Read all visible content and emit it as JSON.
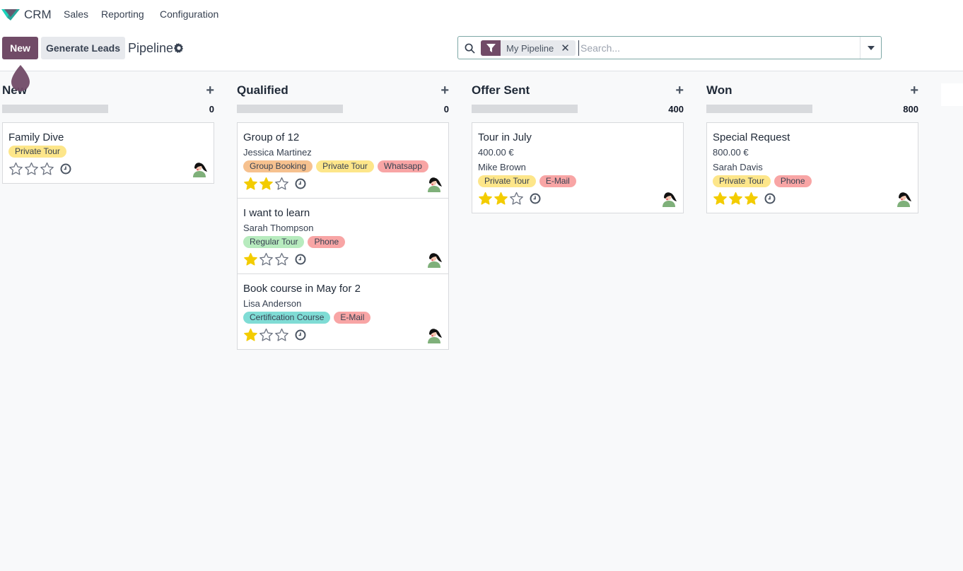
{
  "app": {
    "name": "CRM",
    "menu": [
      "Sales",
      "Reporting",
      "Configuration"
    ],
    "logo_icon": "odoo-crm-logo-icon"
  },
  "control": {
    "new_label": "New",
    "generate_label": "Generate Leads",
    "breadcrumb": "Pipeline",
    "gear_icon": "gear-icon"
  },
  "search": {
    "facet_label": "My Pipeline",
    "facet_remove": "✕",
    "placeholder": "Search...",
    "value": ""
  },
  "colors": {
    "brand": "#714b67",
    "star_filled": "#f3cc00",
    "tag_yellow": "#fde68a",
    "tag_red": "#f8a5a5",
    "tag_orange": "#f6c18f",
    "tag_green": "#b7ebbe",
    "tag_teal": "#7fdcd5"
  },
  "columns": [
    {
      "title": "New",
      "total": "0",
      "cards": [
        {
          "title": "Family Dive",
          "lines": [],
          "tags": [
            {
              "label": "Private Tour",
              "color": "#fde68a"
            }
          ],
          "stars": 0
        }
      ]
    },
    {
      "title": "Qualified",
      "total": "0",
      "cards": [
        {
          "title": "Group of 12",
          "lines": [
            "Jessica Martinez"
          ],
          "tags": [
            {
              "label": "Group Booking",
              "color": "#f6c18f"
            },
            {
              "label": "Private Tour",
              "color": "#fde68a"
            },
            {
              "label": "Whatsapp",
              "color": "#f8a5a5"
            }
          ],
          "stars": 2
        },
        {
          "title": "I want to learn",
          "lines": [
            "Sarah Thompson"
          ],
          "tags": [
            {
              "label": "Regular Tour",
              "color": "#b7ebbe"
            },
            {
              "label": "Phone",
              "color": "#f8a5a5"
            }
          ],
          "stars": 1
        },
        {
          "title": "Book course in May for 2",
          "lines": [
            "Lisa Anderson"
          ],
          "tags": [
            {
              "label": "Certification Course",
              "color": "#7fdcd5"
            },
            {
              "label": "E-Mail",
              "color": "#f8a5a5"
            }
          ],
          "stars": 1
        }
      ]
    },
    {
      "title": "Offer Sent",
      "total": "400",
      "cards": [
        {
          "title": "Tour in July",
          "lines": [
            "400.00 €",
            "Mike Brown"
          ],
          "tags": [
            {
              "label": "Private Tour",
              "color": "#fde68a"
            },
            {
              "label": "E-Mail",
              "color": "#f8a5a5"
            }
          ],
          "stars": 2
        }
      ]
    },
    {
      "title": "Won",
      "total": "800",
      "cards": [
        {
          "title": "Special Request",
          "lines": [
            "800.00 €",
            "Sarah Davis"
          ],
          "tags": [
            {
              "label": "Private Tour",
              "color": "#fde68a"
            },
            {
              "label": "Phone",
              "color": "#f8a5a5"
            }
          ],
          "stars": 3
        }
      ]
    }
  ]
}
